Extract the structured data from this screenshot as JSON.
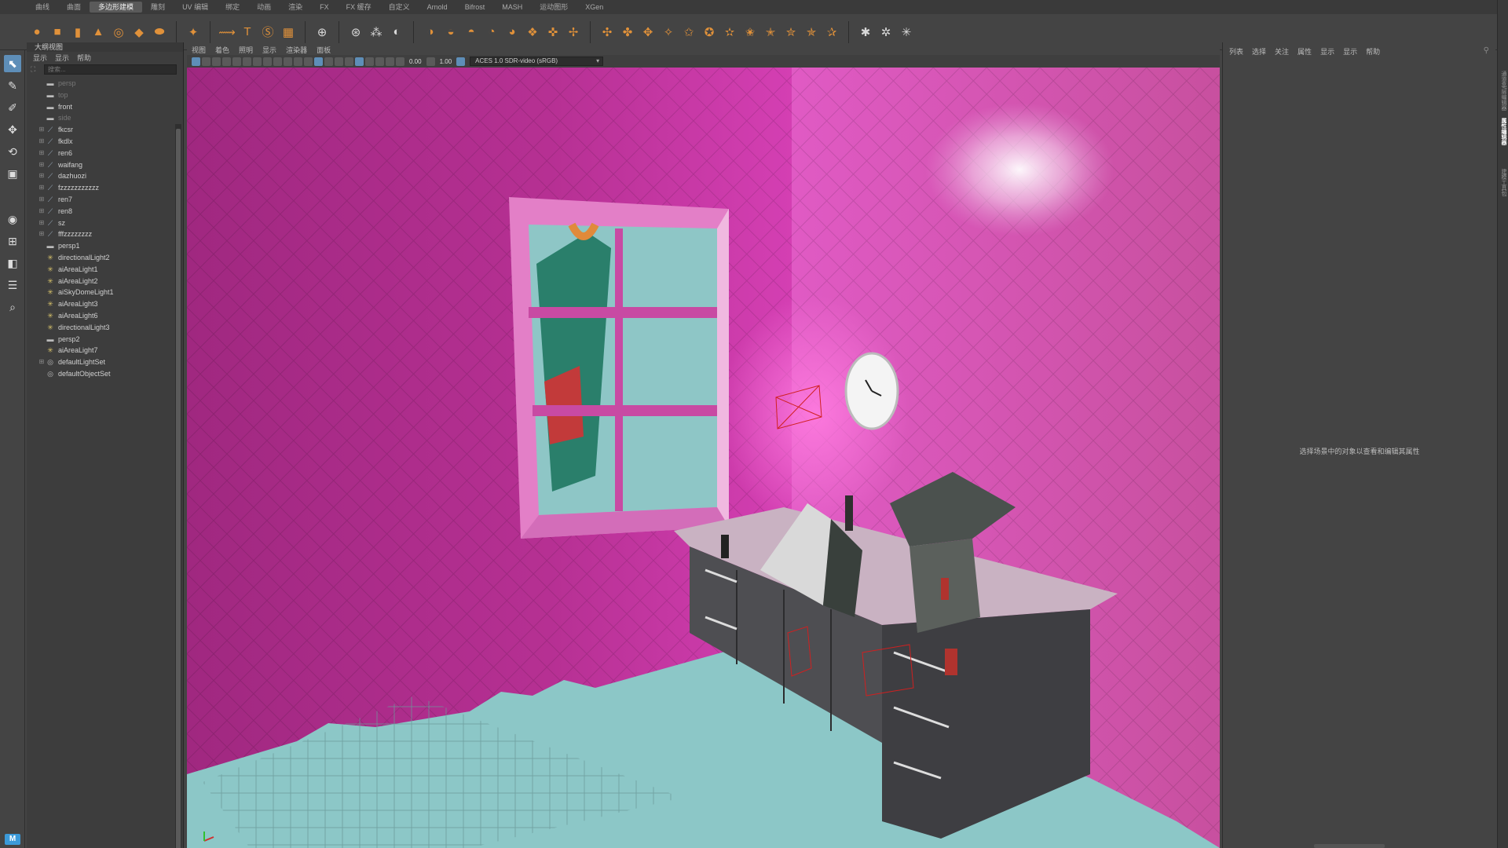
{
  "shelf": {
    "tabs": [
      "曲线",
      "曲面",
      "多边形建模",
      "雕刻",
      "UV 编辑",
      "绑定",
      "动画",
      "渲染",
      "FX",
      "FX 缓存",
      "自定义",
      "Arnold",
      "Bifrost",
      "MASH",
      "运动图形",
      "XGen"
    ],
    "active_tab_index": 2,
    "icons": [
      [
        "sphere-icon",
        "o"
      ],
      [
        "cube-icon",
        "o"
      ],
      [
        "cylinder-icon",
        "o"
      ],
      [
        "cone-icon",
        "o"
      ],
      [
        "torus-icon",
        "o"
      ],
      [
        "plane-icon",
        "o"
      ],
      [
        "disc-icon",
        "o"
      ],
      [
        "sep"
      ],
      [
        "superellipse-icon",
        "o"
      ],
      [
        "sep"
      ],
      [
        "sweep-icon",
        "o"
      ],
      [
        "type-icon",
        "o"
      ],
      [
        "text-icon",
        "o"
      ],
      [
        "svg-icon",
        "o"
      ],
      [
        "sep"
      ],
      [
        "grid-icon",
        "w"
      ],
      [
        "sep"
      ],
      [
        "center-pivot-icon",
        "w"
      ],
      [
        "snap-icon",
        "w"
      ],
      [
        "freeze-icon",
        "w"
      ],
      [
        "sep"
      ],
      [
        "combine-icon",
        "o"
      ],
      [
        "separate-icon",
        "o"
      ],
      [
        "smooth-icon",
        "o"
      ],
      [
        "mirror-icon",
        "o"
      ],
      [
        "boolean-icon",
        "o"
      ],
      [
        "remesh-icon",
        "o"
      ],
      [
        "retopo-icon",
        "o"
      ],
      [
        "cleanup-icon",
        "o"
      ],
      [
        "sep"
      ],
      [
        "extrude-icon",
        "o"
      ],
      [
        "bridge-icon",
        "o"
      ],
      [
        "bevel-icon",
        "o"
      ],
      [
        "fill-hole-icon",
        "o"
      ],
      [
        "append-icon",
        "o"
      ],
      [
        "multicut-icon",
        "o"
      ],
      [
        "connect-icon",
        "o"
      ],
      [
        "target-weld-icon",
        "o"
      ],
      [
        "collapse-icon",
        "o"
      ],
      [
        "insert-loop-icon",
        "o"
      ],
      [
        "offset-loop-icon",
        "o"
      ],
      [
        "slide-edge-icon",
        "o"
      ],
      [
        "sep"
      ],
      [
        "uv-planar-icon",
        "w"
      ],
      [
        "uv-editor-icon",
        "w"
      ],
      [
        "uv-auto-icon",
        "w"
      ]
    ]
  },
  "toolbox": {
    "tools": [
      [
        "select-tool-icon",
        "⬉",
        true
      ],
      [
        "lasso-tool-icon",
        "✎",
        false
      ],
      [
        "paint-select-icon",
        "✐",
        false
      ],
      [
        "move-tool-icon",
        "✥",
        false
      ],
      [
        "rotate-tool-icon",
        "⟲",
        false
      ],
      [
        "scale-tool-icon",
        "▣",
        false
      ]
    ],
    "layouts": [
      [
        "single-view-icon",
        "◉"
      ],
      [
        "four-view-icon",
        "⊞"
      ],
      [
        "two-view-icon",
        "◧"
      ],
      [
        "outliner-layout-icon",
        "☰"
      ],
      [
        "search-tool-icon",
        "⌕"
      ]
    ],
    "logo": "M"
  },
  "outliner": {
    "title": "大纲视图",
    "menu": [
      "显示",
      "显示",
      "帮助"
    ],
    "search_placeholder": "搜索...",
    "items": [
      {
        "label": "persp",
        "icon": "cam",
        "expand": false,
        "dim": true
      },
      {
        "label": "top",
        "icon": "cam",
        "expand": false,
        "dim": true
      },
      {
        "label": "front",
        "icon": "cam",
        "expand": false,
        "dim": false
      },
      {
        "label": "side",
        "icon": "cam",
        "expand": false,
        "dim": true
      },
      {
        "label": "fkcsr",
        "icon": "xf",
        "expand": true,
        "dim": false
      },
      {
        "label": "fkdlx",
        "icon": "xf",
        "expand": true,
        "dim": false
      },
      {
        "label": "ren6",
        "icon": "xf",
        "expand": true,
        "dim": false
      },
      {
        "label": "waifang",
        "icon": "xf",
        "expand": true,
        "dim": false
      },
      {
        "label": "dazhuozi",
        "icon": "xf",
        "expand": true,
        "dim": false
      },
      {
        "label": "fzzzzzzzzzzz",
        "icon": "xf",
        "expand": true,
        "dim": false
      },
      {
        "label": "ren7",
        "icon": "xf",
        "expand": true,
        "dim": false
      },
      {
        "label": "ren8",
        "icon": "xf",
        "expand": true,
        "dim": false
      },
      {
        "label": "sz",
        "icon": "xf",
        "expand": true,
        "dim": false
      },
      {
        "label": "fffzzzzzzzz",
        "icon": "xf",
        "expand": true,
        "dim": false
      },
      {
        "label": "persp1",
        "icon": "cam",
        "expand": false,
        "dim": false
      },
      {
        "label": "directionalLight2",
        "icon": "lt",
        "expand": false,
        "dim": false
      },
      {
        "label": "aiAreaLight1",
        "icon": "lt",
        "expand": false,
        "dim": false
      },
      {
        "label": "aiAreaLight2",
        "icon": "lt",
        "expand": false,
        "dim": false
      },
      {
        "label": "aiSkyDomeLight1",
        "icon": "lt",
        "expand": false,
        "dim": false
      },
      {
        "label": "aiAreaLight3",
        "icon": "lt",
        "expand": false,
        "dim": false
      },
      {
        "label": "aiAreaLight6",
        "icon": "lt",
        "expand": false,
        "dim": false
      },
      {
        "label": "directionalLight3",
        "icon": "lt",
        "expand": false,
        "dim": false
      },
      {
        "label": "persp2",
        "icon": "cam",
        "expand": false,
        "dim": false
      },
      {
        "label": "aiAreaLight7",
        "icon": "lt",
        "expand": false,
        "dim": false
      },
      {
        "label": "defaultLightSet",
        "icon": "set",
        "expand": true,
        "dim": false
      },
      {
        "label": "defaultObjectSet",
        "icon": "set",
        "expand": false,
        "dim": false
      }
    ]
  },
  "viewport": {
    "menu": [
      "视图",
      "着色",
      "照明",
      "显示",
      "渲染器",
      "面板"
    ],
    "exposure": "0.00",
    "gamma": "1.00",
    "color_space": "ACES 1.0 SDR-video (sRGB)"
  },
  "attribute_editor": {
    "menu": [
      "列表",
      "选择",
      "关注",
      "属性",
      "显示",
      "显示",
      "帮助"
    ],
    "hint": "选择场景中的对象以查看和编辑其属性"
  },
  "right_strip": {
    "tabs": [
      "通道盒/层编辑器",
      "属性编辑器",
      "建模工具包"
    ]
  },
  "colors": {
    "accent": "#5e8eb8",
    "wall_magenta": "#c43a9c",
    "floor_cyan": "#8cc7c7"
  }
}
